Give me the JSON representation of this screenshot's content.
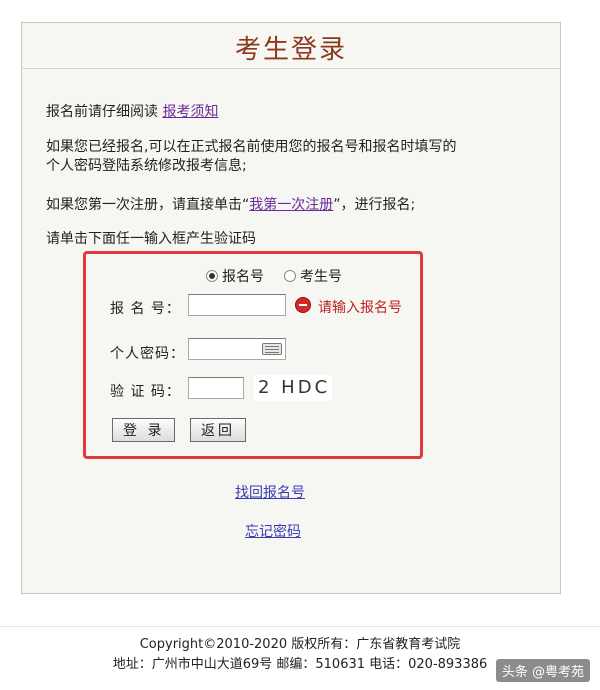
{
  "header": {
    "title": "考生登录"
  },
  "notice": {
    "prefix": "报名前请仔细阅读",
    "link": "报考须知"
  },
  "info_lines": [
    "如果您已经报名,可以在正式报名前使用您的报名号和报名时填写的",
    "个人密码登陆系统修改报考信息;"
  ],
  "first_time": {
    "prefix": "如果您第一次注册，请直接单击“",
    "link": "我第一次注册",
    "suffix": "”，进行报名;"
  },
  "captcha_prompt": "请单击下面任一输入框产生验证码",
  "form": {
    "radio_options": [
      {
        "label": "报名号",
        "checked": true
      },
      {
        "label": "考生号",
        "checked": false
      }
    ],
    "registration_label": "报 名 号：",
    "registration_value": "",
    "registration_error": "请输入报名号",
    "password_label": "个人密码：",
    "captcha_label": "验 证 码：",
    "captcha_image_text": "2 HDC",
    "login_button": "登 录",
    "back_button": "返回"
  },
  "links": {
    "recover_registration": "找回报名号",
    "forgot_password": "忘记密码"
  },
  "footer": {
    "copyright": "Copyright©2010-2020 版权所有：广东省教育考试院",
    "address": "地址：广州市中山大道69号 邮编：510631 电话：020-893386"
  },
  "watermark": "头条 @粤考苑"
}
